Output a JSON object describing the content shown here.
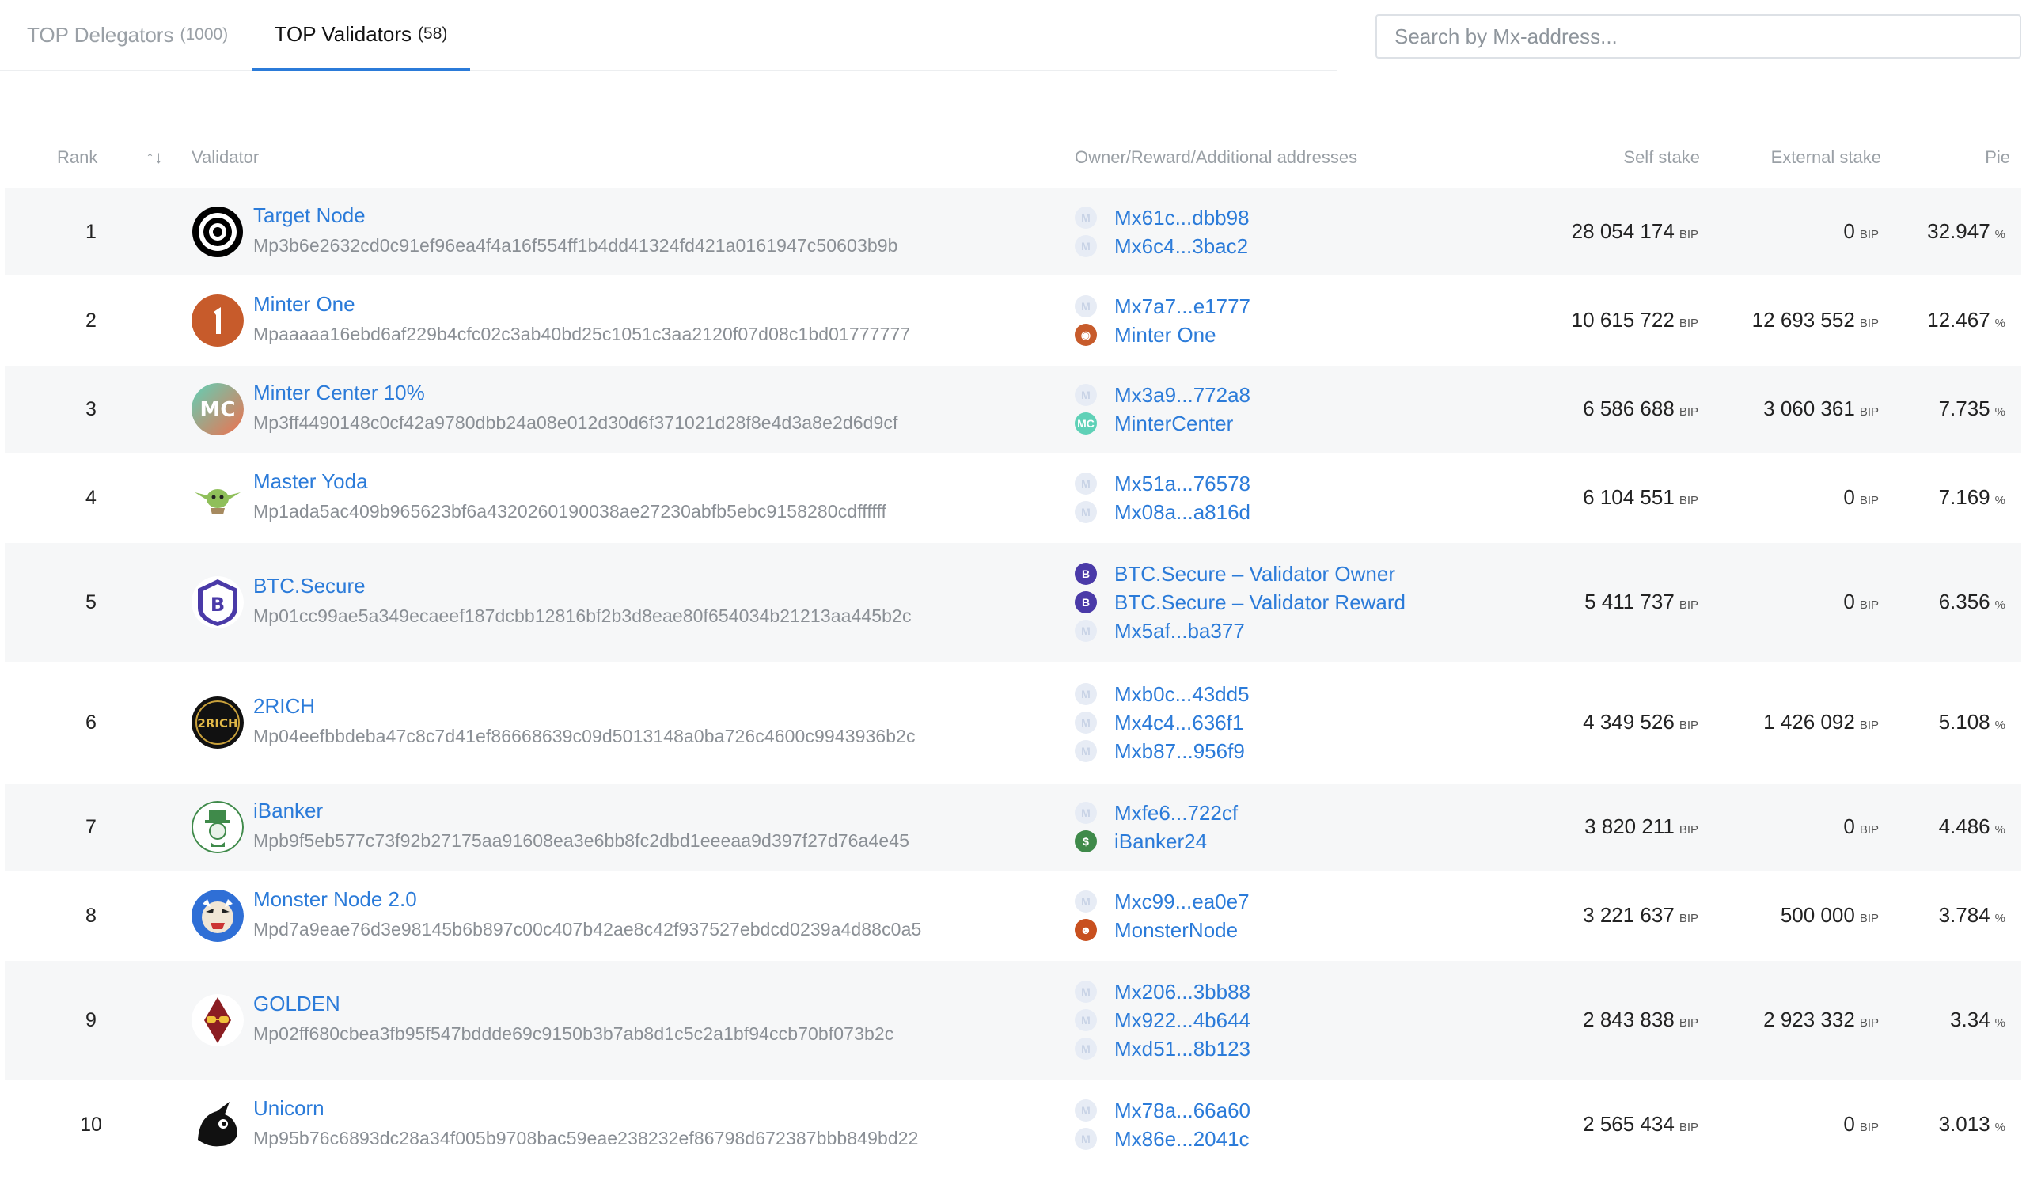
{
  "tabs": [
    {
      "label": "TOP Delegators",
      "count": "(1000)"
    },
    {
      "label": "TOP Validators",
      "count": "(58)"
    }
  ],
  "search": {
    "placeholder": "Search by Mx-address..."
  },
  "columns": {
    "rank": "Rank",
    "sort_icon": "↑↓",
    "validator": "Validator",
    "addresses": "Owner/Reward/Additional addresses",
    "self_stake": "Self stake",
    "external_stake": "External stake",
    "pie": "Pie"
  },
  "units": {
    "coin": "BIP",
    "percent": "%"
  },
  "rows": [
    {
      "rank": "1",
      "name": "Target Node",
      "key": "Mp3b6e2632cd0c91ef96ea4f4a16f554ff1b4dd41324fd421a0161947c50603b9b",
      "logo": "target-logo",
      "addresses": [
        {
          "text": "Mx61c...dbb98",
          "icon": "placeholder"
        },
        {
          "text": "Mx6c4...3bac2",
          "icon": "placeholder"
        }
      ],
      "self": "28 054 174",
      "ext": "0",
      "pie": "32.947"
    },
    {
      "rank": "2",
      "name": "Minter One",
      "key": "Mpaaaaa16ebd6af229b4cfc02c3ab40bd25c1051c3aa2120f07d08c1bd01777777",
      "logo": "minter-one-logo",
      "addresses": [
        {
          "text": "Mx7a7...e1777",
          "icon": "placeholder"
        },
        {
          "text": "Minter One",
          "icon": "minter-one"
        }
      ],
      "self": "10 615 722",
      "ext": "12 693 552",
      "pie": "12.467"
    },
    {
      "rank": "3",
      "name": "Minter Center 10%",
      "key": "Mp3ff4490148c0cf42a9780dbb24a08e012d30d6f371021d28f8e4d3a8e2d6d9cf",
      "logo": "minter-center-logo",
      "addresses": [
        {
          "text": "Mx3a9...772a8",
          "icon": "placeholder"
        },
        {
          "text": "MinterCenter",
          "icon": "minter-center"
        }
      ],
      "self": "6 586 688",
      "ext": "3 060 361",
      "pie": "7.735"
    },
    {
      "rank": "4",
      "name": "Master Yoda",
      "key": "Mp1ada5ac409b965623bf6a4320260190038ae27230abfb5ebc9158280cdffffff",
      "logo": "yoda-logo",
      "addresses": [
        {
          "text": "Mx51a...76578",
          "icon": "placeholder"
        },
        {
          "text": "Mx08a...a816d",
          "icon": "placeholder"
        }
      ],
      "self": "6 104 551",
      "ext": "0",
      "pie": "7.169"
    },
    {
      "rank": "5",
      "name": "BTC.Secure",
      "key": "Mp01cc99ae5a349ecaeef187dcbb12816bf2b3d8eae80f654034b21213aa445b2c",
      "logo": "btc-secure-logo",
      "addresses": [
        {
          "text": "BTC.Secure – Validator Owner",
          "icon": "btc-secure"
        },
        {
          "text": "BTC.Secure – Validator Reward",
          "icon": "btc-secure"
        },
        {
          "text": "Mx5af...ba377",
          "icon": "placeholder"
        }
      ],
      "self": "5 411 737",
      "ext": "0",
      "pie": "6.356"
    },
    {
      "rank": "6",
      "name": "2RICH",
      "key": "Mp04eefbbdeba47c8c7d41ef86668639c09d5013148a0ba726c4600c9943936b2c",
      "logo": "2rich-logo",
      "addresses": [
        {
          "text": "Mxb0c...43dd5",
          "icon": "placeholder"
        },
        {
          "text": "Mx4c4...636f1",
          "icon": "placeholder"
        },
        {
          "text": "Mxb87...956f9",
          "icon": "placeholder"
        }
      ],
      "self": "4 349 526",
      "ext": "1 426 092",
      "pie": "5.108"
    },
    {
      "rank": "7",
      "name": "iBanker",
      "key": "Mpb9f5eb577c73f92b27175aa91608ea3e6bb8fc2dbd1eeeaa9d397f27d76a4e45",
      "logo": "ibanker-logo",
      "addresses": [
        {
          "text": "Mxfe6...722cf",
          "icon": "placeholder"
        },
        {
          "text": "iBanker24",
          "icon": "ibanker"
        }
      ],
      "self": "3 820 211",
      "ext": "0",
      "pie": "4.486"
    },
    {
      "rank": "8",
      "name": "Monster Node 2.0",
      "key": "Mpd7a9eae76d3e98145b6b897c00c407b42ae8c42f937527ebdcd0239a4d88c0a5",
      "logo": "monster-logo",
      "addresses": [
        {
          "text": "Mxc99...ea0e7",
          "icon": "placeholder"
        },
        {
          "text": "MonsterNode",
          "icon": "monster"
        }
      ],
      "self": "3 221 637",
      "ext": "500 000",
      "pie": "3.784"
    },
    {
      "rank": "9",
      "name": "GOLDEN",
      "key": "Mp02ff680cbea3fb95f547bddde69c9150b3b7ab8d1c5c2a1bf94ccb70bf073b2c",
      "logo": "golden-logo",
      "addresses": [
        {
          "text": "Mx206...3bb88",
          "icon": "placeholder"
        },
        {
          "text": "Mx922...4b644",
          "icon": "placeholder"
        },
        {
          "text": "Mxd51...8b123",
          "icon": "placeholder"
        }
      ],
      "self": "2 843 838",
      "ext": "2 923 332",
      "pie": "3.34"
    },
    {
      "rank": "10",
      "name": "Unicorn",
      "key": "Mp95b76c6893dc28a34f005b9708bac59eae238232ef86798d672387bbb849bd22",
      "logo": "unicorn-logo",
      "addresses": [
        {
          "text": "Mx78a...66a60",
          "icon": "placeholder"
        },
        {
          "text": "Mx86e...2041c",
          "icon": "placeholder"
        }
      ],
      "self": "2 565 434",
      "ext": "0",
      "pie": "3.013"
    }
  ],
  "colors": {
    "link": "#2b7bd9",
    "row_alt": "#f6f7f8",
    "tab_active_underline": "#2b7bd9"
  }
}
